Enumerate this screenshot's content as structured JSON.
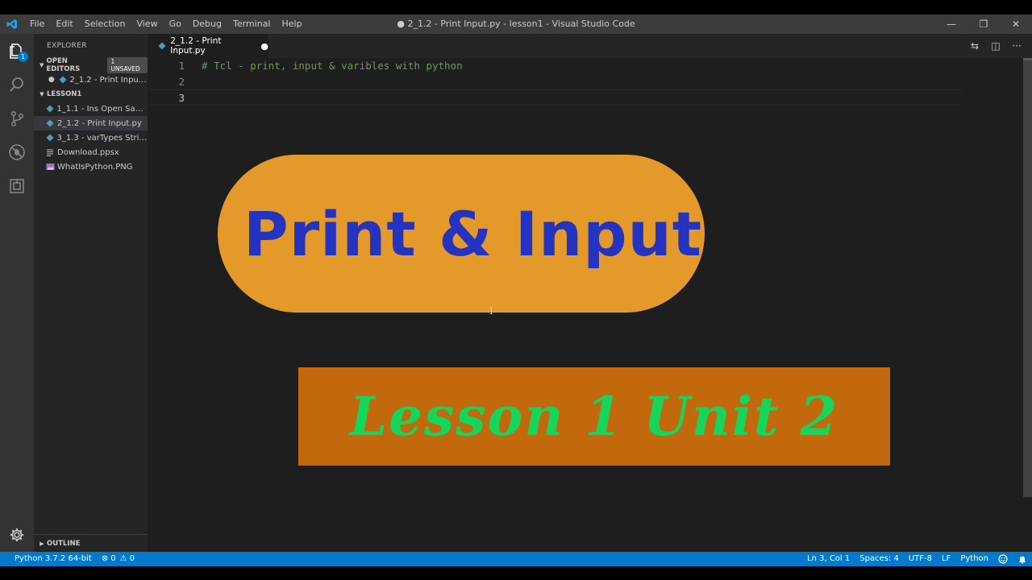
{
  "window": {
    "title": "● 2_1.2 - Print Input.py - lesson1 - Visual Studio Code",
    "minimize": "—",
    "restore": "❐",
    "close": "✕"
  },
  "menu": [
    "File",
    "Edit",
    "Selection",
    "View",
    "Go",
    "Debug",
    "Terminal",
    "Help"
  ],
  "activity": {
    "explorer_badge": "1"
  },
  "sidebar": {
    "title": "EXPLORER",
    "open_editors": {
      "label": "OPEN EDITORS",
      "badge": "1 UNSAVED",
      "items": [
        {
          "dot": "●",
          "label": "2_1.2 - Print Input..."
        }
      ]
    },
    "folder": {
      "label": "LESSON1",
      "items": [
        {
          "label": "1_1.1 - Ins Open Save...",
          "icon": "python-icon"
        },
        {
          "label": "2_1.2 - Print Input.py",
          "icon": "python-icon"
        },
        {
          "label": "3_1.3 - varTypes Strin...",
          "icon": "python-icon"
        },
        {
          "label": "Download.ppsx",
          "icon": "file-lines-icon"
        },
        {
          "label": "WhatIsPython.PNG",
          "icon": "image-icon"
        }
      ]
    },
    "outline_label": "OUTLINE"
  },
  "editor": {
    "tab": {
      "label": "2_1.2 - Print Input.py",
      "dirty": "●"
    },
    "actions": [
      "⇆",
      "◫",
      "···"
    ],
    "lines": [
      {
        "no": "1",
        "text": "# Tcl - print, input & varibles with python"
      },
      {
        "no": "2",
        "text": ""
      },
      {
        "no": "3",
        "text": ""
      }
    ],
    "cursor": "I",
    "banner_title": "Print & Input",
    "banner_subtitle": "Lesson 1 Unit 2"
  },
  "status": {
    "python": "Python 3.7.2 64-bit",
    "errors": "0",
    "warnings": "0",
    "position": "Ln 3, Col 1",
    "spaces": "Spaces: 4",
    "encoding": "UTF-8",
    "eol": "LF",
    "language": "Python"
  },
  "colors": {
    "accent": "#007acc",
    "pill": "#e49a2a",
    "pill_text": "#2433c0",
    "rect": "#c1690c",
    "rect_text": "#17d45a",
    "comment": "#6a9955"
  }
}
